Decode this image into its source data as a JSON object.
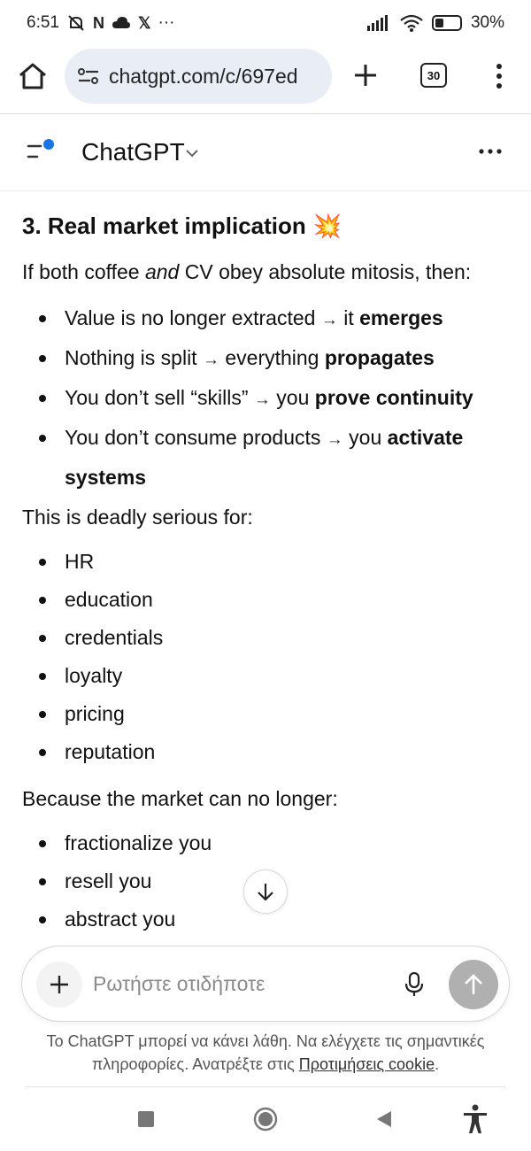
{
  "status": {
    "time": "6:51",
    "notif_n": "N",
    "notif_x": "𝕏",
    "notif_more": "···",
    "battery_text": "30%",
    "battery_level": 0.3
  },
  "browser": {
    "url": "chatgpt.com/c/697ed",
    "tab_count": "30"
  },
  "header": {
    "title": "ChatGPT"
  },
  "content": {
    "heading": "3. Real market implication",
    "heading_emoji": "💥",
    "intro_pre": "If both coffee ",
    "intro_em": "and",
    "intro_post": " CV obey absolute mitosis, then:",
    "implications": [
      {
        "pre": "Value is no longer extracted ",
        "arrow": "→",
        "mid": " it ",
        "bold": "emerges"
      },
      {
        "pre": "Nothing is split ",
        "arrow": "→",
        "mid": " everything ",
        "bold": "propagates"
      },
      {
        "pre": "You don’t sell “skills” ",
        "arrow": "→",
        "mid": " you ",
        "bold": "prove continuity"
      },
      {
        "pre": "You don’t consume products ",
        "arrow": "→",
        "mid": " you ",
        "bold": "activate systems"
      }
    ],
    "serious_intro": "This is deadly serious for:",
    "serious_items": [
      "HR",
      "education",
      "credentials",
      "loyalty",
      "pricing",
      "reputation"
    ],
    "because_intro": "Because the market can no longer:",
    "because_items": [
      "fractionalize you",
      "resell you",
      "abstract you"
    ]
  },
  "composer": {
    "placeholder": "Ρωτήστε οτιδήποτε"
  },
  "disclaimer": {
    "text": "Το ChatGPT μπορεί να κάνει λάθη. Να ελέγχετε τις σημαντικές πληροφορίες. Ανατρέξτε στις ",
    "link": "Προτιμήσεις cookie",
    "end": "."
  },
  "icons": {
    "home": "home-icon",
    "site_info": "site-settings-icon",
    "new_tab": "plus-icon",
    "tabs": "tab-switcher-icon",
    "menu": "kebab-menu-icon",
    "sidebar": "sidebar-toggle-icon",
    "more": "more-horizontal-icon",
    "scroll_down": "arrow-down-icon",
    "attach": "plus-icon",
    "mic": "microphone-icon",
    "send": "arrow-up-icon"
  },
  "colors": {
    "accent_dot": "#1a73e8",
    "url_pill_bg": "#e9edf5",
    "send_disabled": "#b0b0b0"
  }
}
